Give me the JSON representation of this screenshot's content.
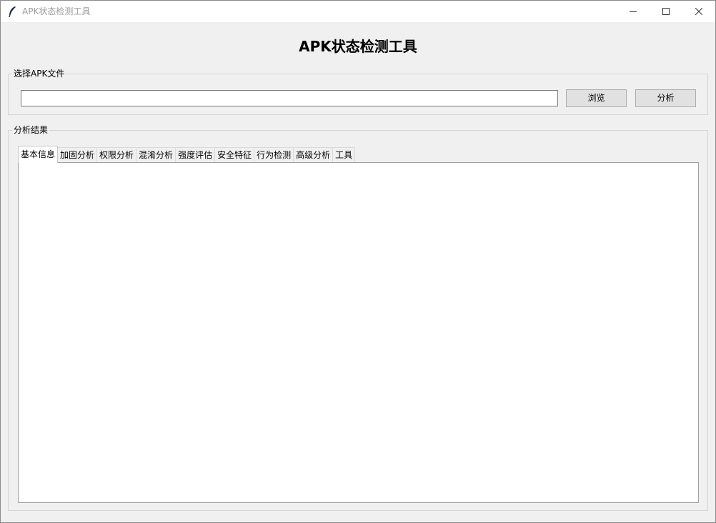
{
  "window": {
    "title": "APK状态检测工具"
  },
  "header": {
    "title": "APK状态检测工具"
  },
  "file_group": {
    "label": "选择APK文件",
    "path_value": "",
    "browse_label": "浏览",
    "analyze_label": "分析"
  },
  "result_group": {
    "label": "分析结果",
    "tabs": [
      {
        "label": "基本信息",
        "active": true
      },
      {
        "label": "加固分析",
        "active": false
      },
      {
        "label": "权限分析",
        "active": false
      },
      {
        "label": "混淆分析",
        "active": false
      },
      {
        "label": "强度评估",
        "active": false
      },
      {
        "label": "安全特征",
        "active": false
      },
      {
        "label": "行为检测",
        "active": false
      },
      {
        "label": "高级分析",
        "active": false
      },
      {
        "label": "工具",
        "active": false
      }
    ]
  },
  "icons": {
    "app": "feather-icon",
    "minimize": "minimize-icon",
    "maximize": "maximize-icon",
    "close": "close-icon"
  }
}
